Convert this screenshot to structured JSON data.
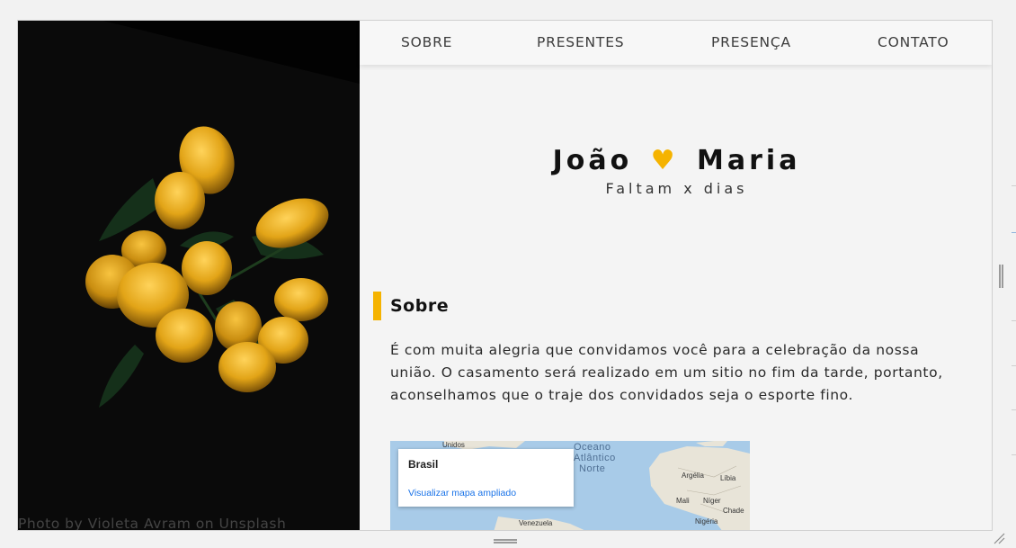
{
  "nav": {
    "items": [
      "SOBRE",
      "PRESENTES",
      "PRESENÇA",
      "CONTATO"
    ]
  },
  "hero": {
    "name_left": "João",
    "heart": "♥",
    "name_right": "Maria",
    "countdown": "Faltam x dias"
  },
  "photo": {
    "credit": "Photo by Violeta Avram on Unsplash"
  },
  "about": {
    "title": "Sobre",
    "text": "É com muita alegria que convidamos você para a celebração da nossa união. O casamento será realizado em um sitio no fim da tarde, portanto, aconselhamos que o traje dos convidados seja o esporte fino."
  },
  "map": {
    "place": "Brasil",
    "link": "Visualizar mapa ampliado",
    "ocean": [
      "Oceano",
      "Atlântico",
      "Norte"
    ],
    "labels": [
      "Unidos",
      "Argélia",
      "Líbia",
      "Mali",
      "Níger",
      "Chade",
      "Nigéria",
      "Venezuela"
    ]
  },
  "colors": {
    "accent": "#f5b300",
    "map_water": "#a8cbe8",
    "map_land": "#e8e4d8"
  },
  "icons": [
    "heart-icon",
    "resize-handle-icon",
    "corner-resize-icon"
  ]
}
